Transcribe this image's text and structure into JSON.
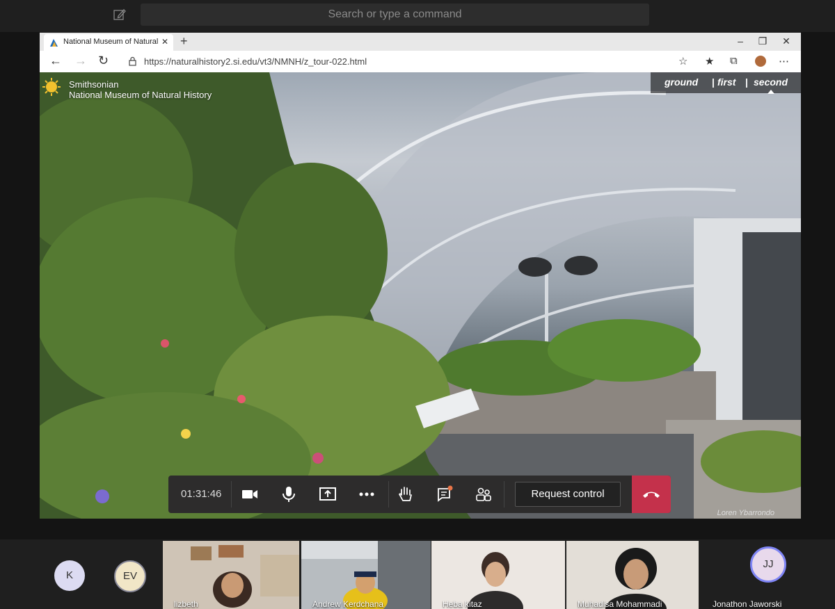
{
  "teams": {
    "search_placeholder": "Search or type a command"
  },
  "browser": {
    "tab_title": "National Museum of Natural His",
    "url": "https://naturalhistory2.si.edu/vt3/NMNH/z_tour-022.html"
  },
  "tour": {
    "brand_line1": "Smithsonian",
    "brand_line2": "National Museum of Natural History",
    "floors": [
      "ground",
      "first",
      "second"
    ],
    "active_floor": "second",
    "photo_credit": "Loren Ybarrondo"
  },
  "call_controls": {
    "timer": "01:31:46",
    "request_control_label": "Request control",
    "icons": [
      "camera-icon",
      "microphone-icon",
      "share-screen-icon",
      "more-icon",
      "raise-hand-icon",
      "chat-icon",
      "participants-icon",
      "hang-up-icon"
    ]
  },
  "participants": [
    {
      "initials": "K",
      "name": ""
    },
    {
      "initials": "EV",
      "name": ""
    },
    {
      "initials": "",
      "name": "lizbeth"
    },
    {
      "initials": "",
      "name": "Andrew Kerdchana"
    },
    {
      "initials": "",
      "name": "Heba kitaz"
    },
    {
      "initials": "",
      "name": "Muhadisa Mohammadi"
    },
    {
      "initials": "JJ",
      "name": "Jonathon Jaworski"
    }
  ],
  "colors": {
    "teams_bg": "#1f1f1f",
    "hangup": "#c4314b",
    "avatar_bg": "#dcdbf2"
  }
}
